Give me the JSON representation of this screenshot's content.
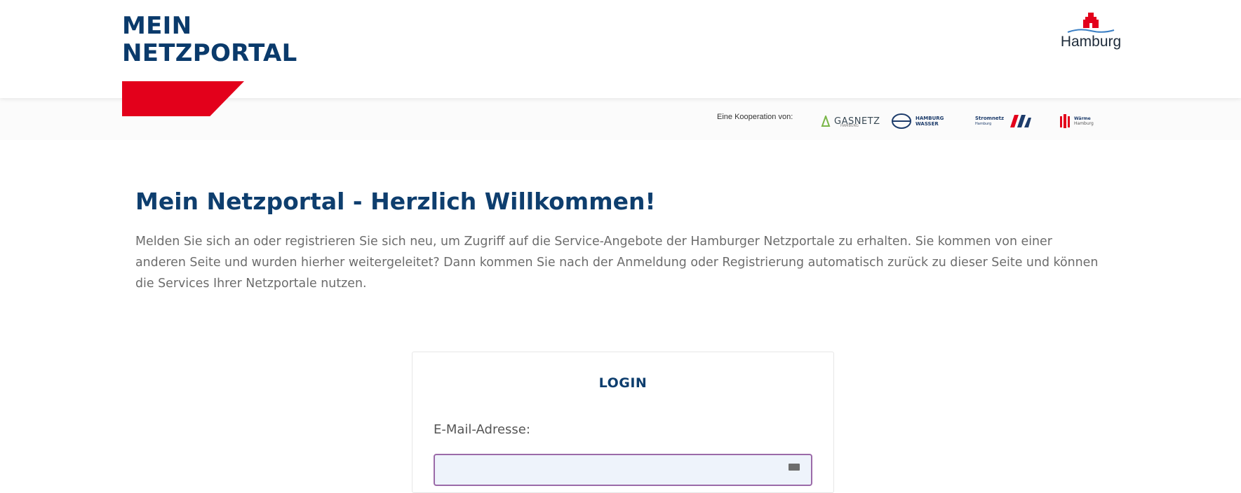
{
  "brand": {
    "title_line1": "MEIN",
    "title_line2": "NETZPORTAL",
    "accent_color": "#e3001b",
    "primary_color": "#0e3e6e"
  },
  "hamburg_logo": {
    "label": "Hamburg",
    "icon": "hamburg-castle-icon"
  },
  "cooperation": {
    "label": "Eine Kooperation von:",
    "partners": [
      {
        "icon": "gasnetz-hamburg-logo-icon",
        "name": "GASNETZ",
        "sub": "HAMBURG"
      },
      {
        "icon": "hamburg-wasser-logo-icon",
        "name_line1": "HAMBURG",
        "name_line2": "WASSER"
      },
      {
        "icon": "stromnetz-hamburg-logo-icon",
        "name": "Stromnetz",
        "sub": "Hamburg"
      },
      {
        "icon": "waerme-hamburg-logo-icon",
        "name": "Wärme",
        "sub": "Hamburg"
      }
    ]
  },
  "welcome": {
    "title": "Mein Netzportal - Herzlich Willkommen!",
    "text": "Melden Sie sich an oder registrieren Sie sich neu, um Zugriff auf die Service-Angebote der Hamburger Netzportale zu erhalten. Sie kommen von einer anderen Seite und wurden hierher weitergeleitet? Dann kommen Sie nach der Anmeldung oder Registrierung automatisch zurück zu dieser Seite und können die Services Ihrer Netzportale nutzen."
  },
  "login": {
    "title": "LOGIN",
    "email_label": "E-Mail-Adresse:",
    "email_value": "",
    "email_placeholder": ""
  }
}
